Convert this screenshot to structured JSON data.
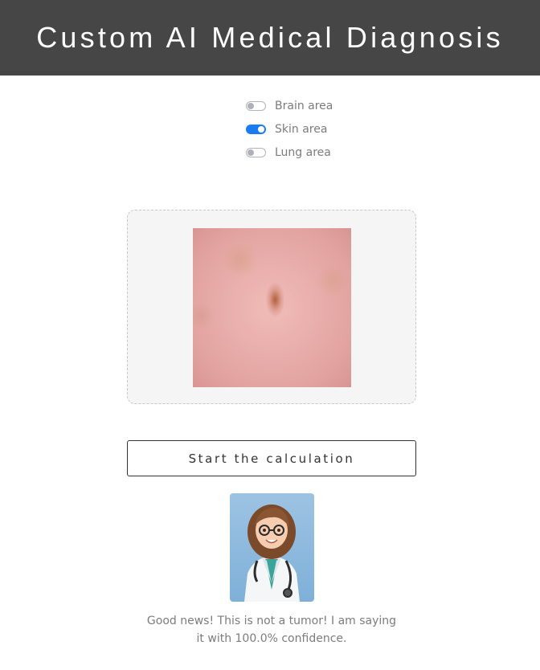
{
  "header": {
    "title": "Custom AI Medical Diagnosis"
  },
  "areas": [
    {
      "label": "Brain area",
      "selected": false
    },
    {
      "label": "Skin area",
      "selected": true
    },
    {
      "label": "Lung area",
      "selected": false
    }
  ],
  "upload": {
    "image_subject": "skin lesion photo"
  },
  "actions": {
    "start_label": "Start the calculation"
  },
  "assistant": {
    "avatar_subject": "cartoon doctor with glasses and stethoscope",
    "message_line1": "Good news! This is not a tumor! I am saying",
    "message_line2": "it with 100.0% confidence."
  },
  "colors": {
    "header_bg": "#464646",
    "toggle_on": "#1a7cf5",
    "toggle_off": "#aeb2b6",
    "text_muted": "#7c7c7c"
  }
}
